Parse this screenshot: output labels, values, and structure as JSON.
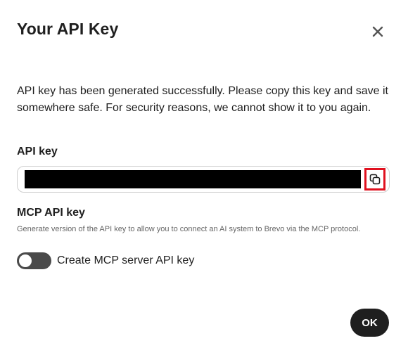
{
  "dialog": {
    "title": "Your API Key",
    "close_icon": "close-icon",
    "message": "API key has been generated successfully. Please copy this key and save it somewhere safe. For security reasons, we cannot show it to you again."
  },
  "api_key": {
    "label": "API key",
    "value_redacted": true,
    "copy_icon": "copy-icon",
    "copy_highlight_color": "#e0111f"
  },
  "mcp": {
    "title": "MCP API key",
    "description": "Generate version of the API key to allow you to connect an AI system to Brevo via the MCP protocol.",
    "toggle_label": "Create MCP server API key",
    "toggle_on": false
  },
  "footer": {
    "ok_label": "OK"
  },
  "colors": {
    "text": "#1f1f1f",
    "muted": "#666666",
    "button_bg": "#1f1f1f",
    "toggle_bg": "#4a4a4a",
    "highlight": "#e0111f"
  }
}
